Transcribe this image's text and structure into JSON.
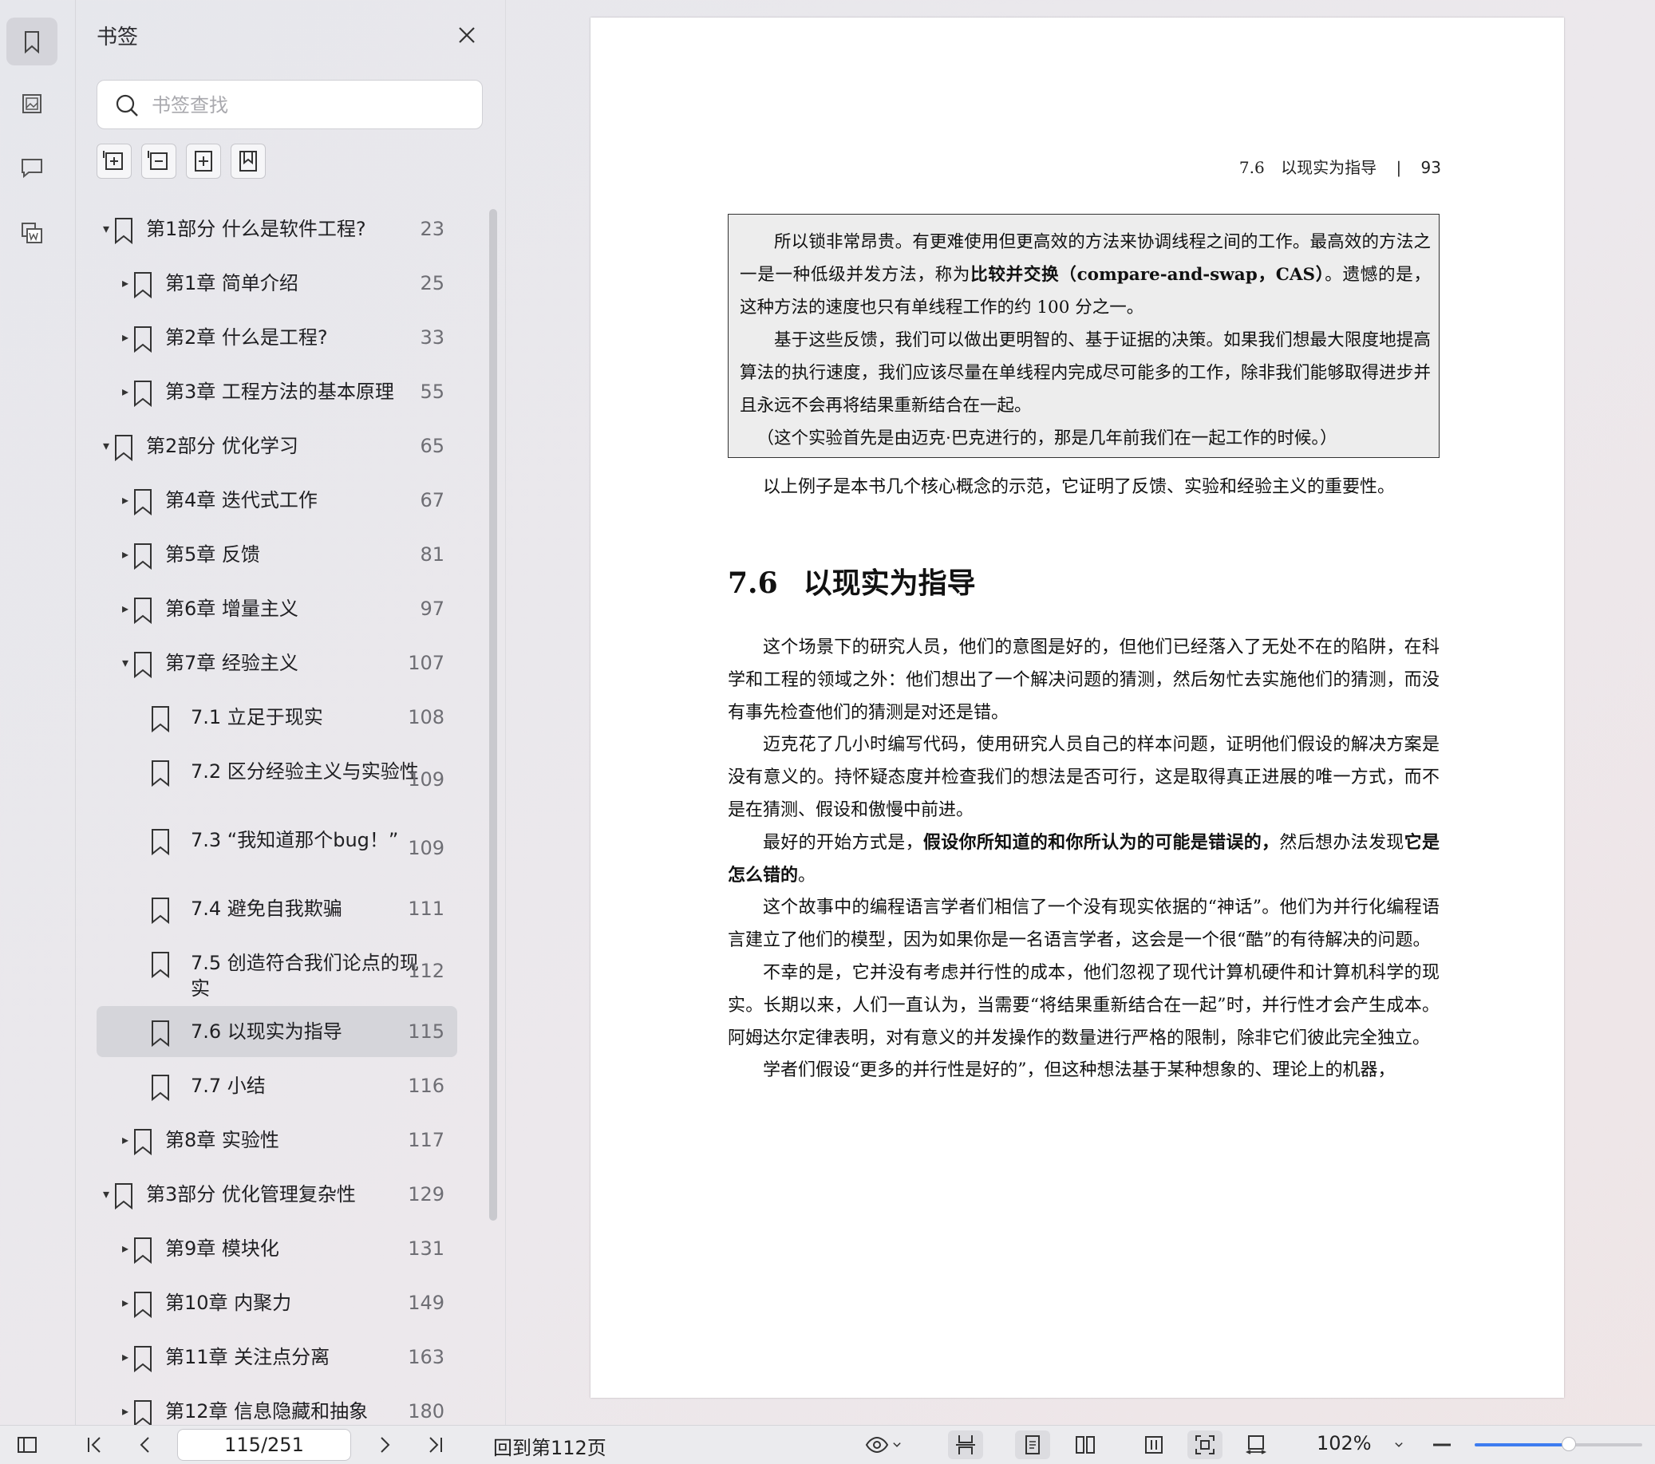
{
  "sidebar": {
    "title": "书签",
    "search_placeholder": "书签查找",
    "items": [
      {
        "label": "第1部分 什么是软件工程?",
        "page": "23",
        "level": 0,
        "expanded": true
      },
      {
        "label": "第1章 简单介绍",
        "page": "25",
        "level": 1,
        "expanded": false
      },
      {
        "label": "第2章 什么是工程?",
        "page": "33",
        "level": 1,
        "expanded": false
      },
      {
        "label": "第3章 工程方法的基本原理",
        "page": "55",
        "level": 1,
        "expanded": false
      },
      {
        "label": "第2部分 优化学习",
        "page": "65",
        "level": 0,
        "expanded": true
      },
      {
        "label": "第4章 迭代式工作",
        "page": "67",
        "level": 1,
        "expanded": false
      },
      {
        "label": "第5章 反馈",
        "page": "81",
        "level": 1,
        "expanded": false
      },
      {
        "label": "第6章 增量主义",
        "page": "97",
        "level": 1,
        "expanded": false
      },
      {
        "label": "第7章 经验主义",
        "page": "107",
        "level": 1,
        "expanded": true
      },
      {
        "label": "7.1 立足于现实",
        "page": "108",
        "level": 2
      },
      {
        "label": "7.2 区分经验主义与实验性",
        "page": "109",
        "level": 2
      },
      {
        "label": "7.3 “我知道那个bug！”",
        "page": "109",
        "level": 2
      },
      {
        "label": "7.4 避免自我欺骗",
        "page": "111",
        "level": 2
      },
      {
        "label": "7.5 创造符合我们论点的现实",
        "page": "112",
        "level": 2
      },
      {
        "label": "7.6 以现实为指导",
        "page": "115",
        "level": 2,
        "selected": true
      },
      {
        "label": "7.7 小结",
        "page": "116",
        "level": 2
      },
      {
        "label": "第8章 实验性",
        "page": "117",
        "level": 1,
        "expanded": false
      },
      {
        "label": "第3部分 优化管理复杂性",
        "page": "129",
        "level": 0,
        "expanded": true
      },
      {
        "label": "第9章 模块化",
        "page": "131",
        "level": 1,
        "expanded": false
      },
      {
        "label": "第10章 内聚力",
        "page": "149",
        "level": 1,
        "expanded": false
      },
      {
        "label": "第11章 关注点分离",
        "page": "163",
        "level": 1,
        "expanded": false
      },
      {
        "label": "第12章 信息隐藏和抽象",
        "page": "180",
        "level": 1,
        "expanded": false
      }
    ]
  },
  "document": {
    "running_head_section": "7.6",
    "running_head_title": "以现实为指导",
    "running_head_sep": "|",
    "page_number": "93",
    "box_p1_a": "所以锁非常昂贵。有更难使用但更高效的方法来协调线程之间的工作。最高效的方法之一是一种低级并发方法，称为",
    "box_p1_bold": "比较并交换（compare-and-swap，CAS）",
    "box_p1_b": "。遗憾的是，这种方法的速度也只有单线程工作的约 100 分之一。",
    "box_p2": "基于这些反馈，我们可以做出更明智的、基于证据的决策。如果我们想最大限度地提高算法的执行速度，我们应该尽量在单线程内完成尽可能多的工作，除非我们能够取得进步并且永远不会再将结果重新结合在一起。",
    "box_p3": "（这个实验首先是由迈克·巴克进行的，那是几年前我们在一起工作的时候。）",
    "after_box": "以上例子是本书几个核心概念的示范，它证明了反馈、实验和经验主义的重要性。",
    "section_number": "7.6",
    "section_title": "以现实为指导",
    "p1": "这个场景下的研究人员，他们的意图是好的，但他们已经落入了无处不在的陷阱，在科学和工程的领域之外：他们想出了一个解决问题的猜测，然后匆忙去实施他们的猜测，而没有事先检查他们的猜测是对还是错。",
    "p2": "迈克花了几小时编写代码，使用研究人员自己的样本问题，证明他们假设的解决方案是没有意义的。持怀疑态度并检查我们的想法是否可行，这是取得真正进展的唯一方式，而不是在猜测、假设和傲慢中前进。",
    "p3_a": "最好的开始方式是，",
    "p3_bold": "假设你所知道的和你所认为的可能是错误的，",
    "p3_b": "然后想办法发现",
    "p3_bold2": "它是怎么错的",
    "p3_c": "。",
    "p4": "这个故事中的编程语言学者们相信了一个没有现实依据的“神话”。他们为并行化编程语言建立了他们的模型，因为如果你是一名语言学者，这会是一个很“酷”的有待解决的问题。",
    "p5": "不幸的是，它并没有考虑并行性的成本，他们忽视了现代计算机硬件和计算机科学的现实。长期以来，人们一直认为，当需要“将结果重新结合在一起”时，并行性才会产生成本。阿姆达尔定律表明，对有意义的并发操作的数量进行严格的限制，除非它们彼此完全独立。",
    "p6": "学者们假设“更多的并行性是好的”，但这种想法基于某种想象的、理论上的机器，"
  },
  "toolbar": {
    "page_field": "115/251",
    "back_link": "回到第112页",
    "zoom_label": "102%",
    "zoom_fraction": 0.56
  },
  "colors": {
    "accent": "#3d7cf0",
    "selected_row": "#d5d5da"
  }
}
